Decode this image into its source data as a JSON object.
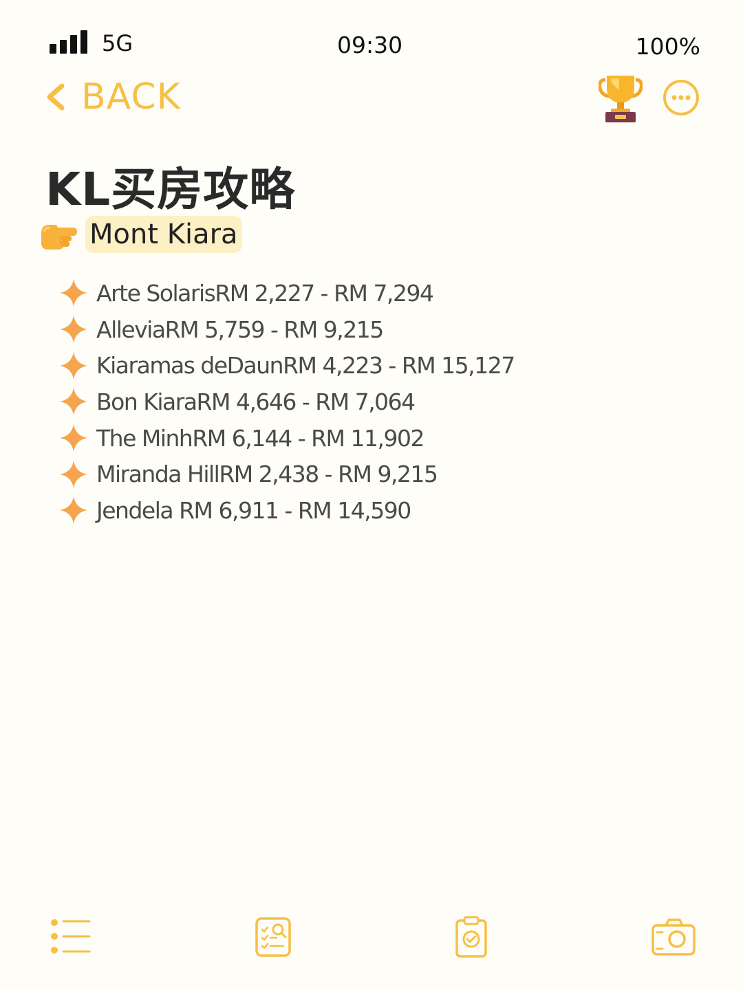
{
  "status_bar": {
    "network": "5G",
    "time": "09:30",
    "battery": "100%",
    "signal_bars": 4
  },
  "nav": {
    "back_label": "BACK",
    "icons": [
      "chevron-left-icon",
      "trophy-icon",
      "more-icon"
    ]
  },
  "note": {
    "title": "KL买房攻略",
    "section": "Mont Kiara",
    "items": [
      "Arte SolarisRM 2,227 - RM 7,294",
      "AlleviaRM 5,759 - RM 9,215",
      "Kiaramas deDaunRM 4,223 - RM 15,127",
      "Bon KiaraRM 4,646 - RM 7,064",
      "The MinhRM 6,144 - RM 11,902",
      "Miranda HillRM 2,438 - RM 9,215",
      "Jendela RM 6,911 - RM 14,590"
    ]
  },
  "toolbar": {
    "icons": [
      "checklist-icon",
      "document-search-icon",
      "clipboard-check-icon",
      "camera-icon"
    ]
  },
  "colors": {
    "accent": "#f7bf45",
    "background": "#fefdf8",
    "sparkle": "#f6a54e",
    "highlight": "#fdf0c4"
  }
}
